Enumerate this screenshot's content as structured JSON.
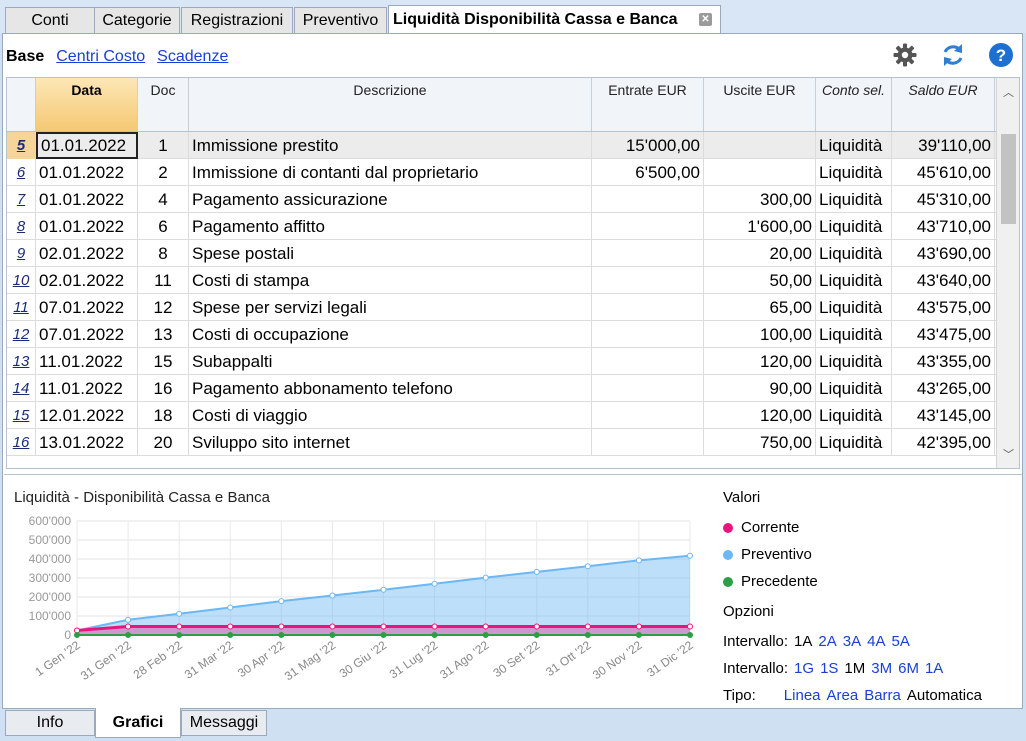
{
  "tabs": [
    {
      "label": "Conti"
    },
    {
      "label": "Categorie"
    },
    {
      "label": "Registrazioni"
    },
    {
      "label": "Preventivo"
    },
    {
      "label": "Liquidità Disponibilità Cassa e Banca"
    }
  ],
  "views": {
    "active": "Base",
    "links": [
      "Centri Costo",
      "Scadenze"
    ]
  },
  "toolbar_icons": [
    "gear-icon",
    "refresh-icon",
    "help-icon"
  ],
  "table": {
    "columns": [
      "Data",
      "Doc",
      "Descrizione",
      "Entrate EUR",
      "Uscite EUR",
      "Conto sel.",
      "Saldo EUR"
    ],
    "rows": [
      {
        "n": "5",
        "date": "01.01.2022",
        "doc": "1",
        "desc": "Immissione prestito",
        "in": "15'000,00",
        "out": "",
        "acct": "Liquidità",
        "bal": "39'110,00"
      },
      {
        "n": "6",
        "date": "01.01.2022",
        "doc": "2",
        "desc": "Immissione di contanti dal proprietario",
        "in": "6'500,00",
        "out": "",
        "acct": "Liquidità",
        "bal": "45'610,00"
      },
      {
        "n": "7",
        "date": "01.01.2022",
        "doc": "4",
        "desc": "Pagamento assicurazione",
        "in": "",
        "out": "300,00",
        "acct": "Liquidità",
        "bal": "45'310,00"
      },
      {
        "n": "8",
        "date": "01.01.2022",
        "doc": "6",
        "desc": "Pagamento affitto",
        "in": "",
        "out": "1'600,00",
        "acct": "Liquidità",
        "bal": "43'710,00"
      },
      {
        "n": "9",
        "date": "02.01.2022",
        "doc": "8",
        "desc": "Spese postali",
        "in": "",
        "out": "20,00",
        "acct": "Liquidità",
        "bal": "43'690,00"
      },
      {
        "n": "10",
        "date": "02.01.2022",
        "doc": "11",
        "desc": "Costi di stampa",
        "in": "",
        "out": "50,00",
        "acct": "Liquidità",
        "bal": "43'640,00"
      },
      {
        "n": "11",
        "date": "07.01.2022",
        "doc": "12",
        "desc": "Spese per servizi legali",
        "in": "",
        "out": "65,00",
        "acct": "Liquidità",
        "bal": "43'575,00"
      },
      {
        "n": "12",
        "date": "07.01.2022",
        "doc": "13",
        "desc": "Costi di occupazione",
        "in": "",
        "out": "100,00",
        "acct": "Liquidità",
        "bal": "43'475,00"
      },
      {
        "n": "13",
        "date": "11.01.2022",
        "doc": "15",
        "desc": "Subappalti",
        "in": "",
        "out": "120,00",
        "acct": "Liquidità",
        "bal": "43'355,00"
      },
      {
        "n": "14",
        "date": "11.01.2022",
        "doc": "16",
        "desc": "Pagamento abbonamento telefono",
        "in": "",
        "out": "90,00",
        "acct": "Liquidità",
        "bal": "43'265,00"
      },
      {
        "n": "15",
        "date": "12.01.2022",
        "doc": "18",
        "desc": "Costi di viaggio",
        "in": "",
        "out": "120,00",
        "acct": "Liquidità",
        "bal": "43'145,00"
      },
      {
        "n": "16",
        "date": "13.01.2022",
        "doc": "20",
        "desc": "Sviluppo sito internet",
        "in": "",
        "out": "750,00",
        "acct": "Liquidità",
        "bal": "42'395,00"
      }
    ]
  },
  "chart_data": {
    "type": "area",
    "title": "Liquidità - Disponibilità Cassa e Banca",
    "ylim": [
      0,
      600000
    ],
    "y_ticks": [
      "0",
      "100'000",
      "200'000",
      "300'000",
      "400'000",
      "500'000",
      "600'000"
    ],
    "categories": [
      "1 Gen '22",
      "31 Gen '22",
      "28 Feb '22",
      "31 Mar '22",
      "30 Apr '22",
      "31 Mag '22",
      "30 Giu '22",
      "31 Lug '22",
      "31 Ago '22",
      "30 Set '22",
      "31 Ott '22",
      "30 Nov '22",
      "31 Dic '22"
    ],
    "series": [
      {
        "name": "Corrente",
        "color": "#e8157e",
        "values": [
          24000,
          45000,
          45000,
          45000,
          45000,
          45000,
          45000,
          45000,
          45000,
          45000,
          45000,
          45000,
          45000
        ]
      },
      {
        "name": "Preventivo",
        "color": "#6cb7f4",
        "values": [
          24000,
          80000,
          112000,
          145000,
          178000,
          208000,
          238000,
          270000,
          302000,
          332000,
          362000,
          393000,
          417000
        ]
      },
      {
        "name": "Precedente",
        "color": "#2e9e45",
        "values": [
          0,
          0,
          0,
          0,
          0,
          0,
          0,
          0,
          0,
          0,
          0,
          0,
          0
        ]
      }
    ],
    "grid": true
  },
  "legend": {
    "heading": "Valori",
    "options_heading": "Opzioni",
    "interval1_label": "Intervallo:",
    "interval1": [
      {
        "t": "1A",
        "active": true
      },
      {
        "t": "2A",
        "active": false
      },
      {
        "t": "3A",
        "active": false
      },
      {
        "t": "4A",
        "active": false
      },
      {
        "t": "5A",
        "active": false
      }
    ],
    "interval2_label": "Intervallo:",
    "interval2": [
      {
        "t": "1G",
        "active": false
      },
      {
        "t": "1S",
        "active": false
      },
      {
        "t": "1M",
        "active": true
      },
      {
        "t": "3M",
        "active": false
      },
      {
        "t": "6M",
        "active": false
      },
      {
        "t": "1A",
        "active": false
      }
    ],
    "type_label": "Tipo:",
    "types": [
      {
        "t": "Linea",
        "active": false
      },
      {
        "t": "Area",
        "active": false
      },
      {
        "t": "Barra",
        "active": false
      },
      {
        "t": "Automatica",
        "active": true
      }
    ]
  },
  "bottom_tabs": [
    "Info",
    "Grafici",
    "Messaggi"
  ]
}
